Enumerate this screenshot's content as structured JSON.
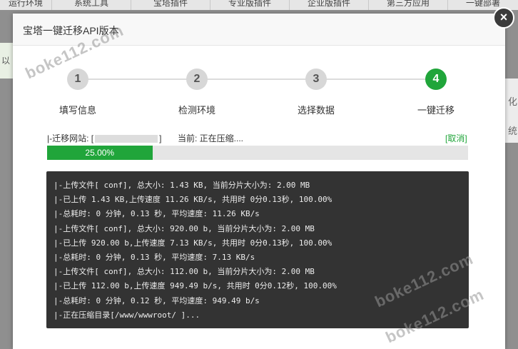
{
  "background_tabs": [
    "运行环境",
    "系统工具",
    "宝塔插件",
    "专业版插件",
    "企业版插件",
    "第三方应用",
    "一键部署"
  ],
  "background_left_text": "以",
  "background_right_texts": [
    "化",
    "统"
  ],
  "dialog": {
    "title": "宝塔一键迁移API版本",
    "close_label": "×"
  },
  "steps": [
    {
      "number": "1",
      "label": "填写信息",
      "active": false
    },
    {
      "number": "2",
      "label": "检测环境",
      "active": false
    },
    {
      "number": "3",
      "label": "选择数据",
      "active": false
    },
    {
      "number": "4",
      "label": "一键迁移",
      "active": true
    }
  ],
  "status": {
    "site_label": "|-迁移网站: [",
    "site_suffix": "]",
    "current_label": "当前: 正在压缩....",
    "cancel_label": "[取消]"
  },
  "progress": {
    "value": 0.25,
    "label": "25.00%"
  },
  "log_lines": [
    "|-上传文件[                  conf], 总大小: 1.43 KB, 当前分片大小为: 2.00 MB",
    "|-已上传 1.43 KB,上传速度 11.26 KB/s, 共用时 0分0.13秒,  100.00%",
    "|-总耗时: 0 分钟, 0.13 秒, 平均速度: 11.26 KB/s",
    "|-上传文件[                  conf], 总大小: 920.00 b, 当前分片大小为: 2.00 MB",
    "|-已上传 920.00 b,上传速度 7.13 KB/s, 共用时 0分0.13秒,  100.00%",
    "|-总耗时: 0 分钟, 0.13 秒, 平均速度: 7.13 KB/s",
    "|-上传文件[                  conf], 总大小: 112.00 b, 当前分片大小为: 2.00 MB",
    "|-已上传 112.00 b,上传速度 949.49 b/s, 共用时 0分0.12秒,  100.00%",
    "|-总耗时: 0 分钟, 0.12 秒, 平均速度: 949.49 b/s",
    "|-正在压缩目录[/www/wwwroot/              ]..."
  ],
  "watermarks": [
    "boke112.com",
    "boke112.com",
    "boke112.com"
  ],
  "colors": {
    "accent": "#20a53a",
    "log_bg": "#333333",
    "step_inactive": "#d7d7d7"
  }
}
